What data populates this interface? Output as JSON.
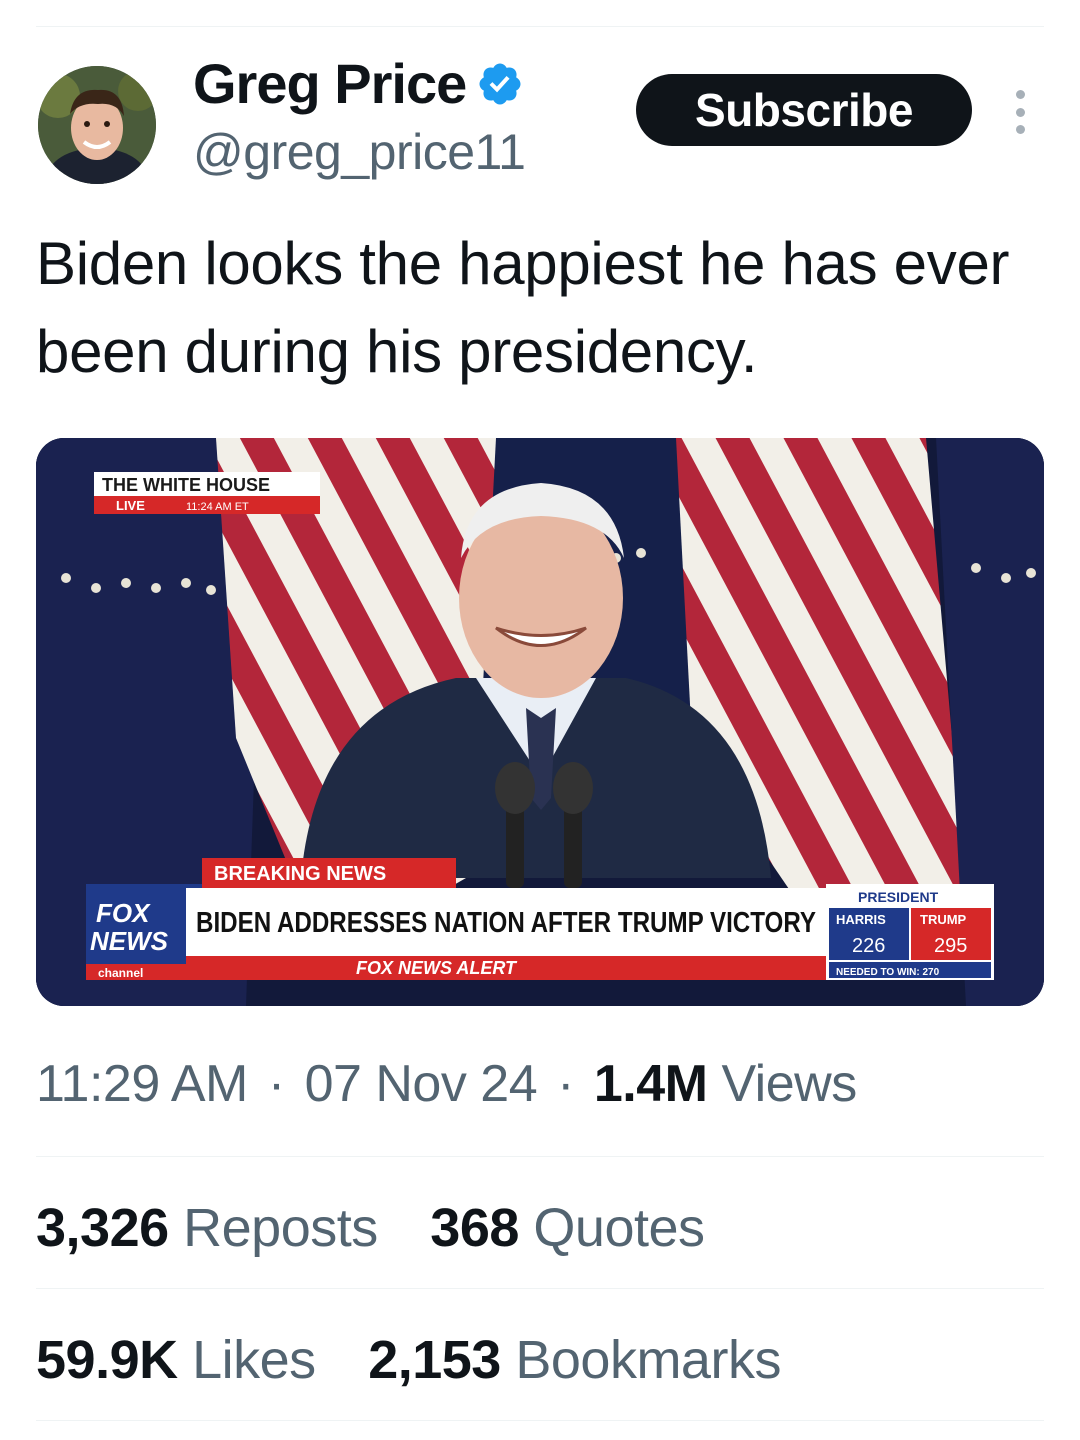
{
  "author": {
    "display_name": "Greg Price",
    "handle": "@greg_price11",
    "verified_icon": "verified-badge-icon"
  },
  "subscribe_label": "Subscribe",
  "more_icon": "more-options-icon",
  "tweet": {
    "text": "Biden looks the happiest he has ever been during his presidency."
  },
  "media": {
    "location_bug": "THE WHITE HOUSE",
    "live_label": "LIVE",
    "live_time": "11:24 AM ET",
    "breaking_label": "BREAKING NEWS",
    "headline": "BIDEN ADDRESSES NATION AFTER TRUMP VICTORY",
    "network_line1": "FOX",
    "network_line2": "NEWS",
    "network_line3": "channel",
    "alert_label": "FOX NEWS ALERT",
    "score_title": "PRESIDENT",
    "harris_label": "HARRIS",
    "harris_votes": "226",
    "trump_label": "TRUMP",
    "trump_votes": "295",
    "needed_label": "NEEDED TO WIN: 270",
    "colors": {
      "fox_blue": "#1f3a8a",
      "fox_red": "#d62828",
      "flag_red": "#b3263a"
    }
  },
  "meta": {
    "time": "11:29 AM",
    "date": "07 Nov 24",
    "views_count": "1.4M",
    "views_label": "Views",
    "separator": "·"
  },
  "stats": {
    "reposts_count": "3,326",
    "reposts_label": "Reposts",
    "quotes_count": "368",
    "quotes_label": "Quotes",
    "likes_count": "59.9K",
    "likes_label": "Likes",
    "bookmarks_count": "2,153",
    "bookmarks_label": "Bookmarks"
  }
}
